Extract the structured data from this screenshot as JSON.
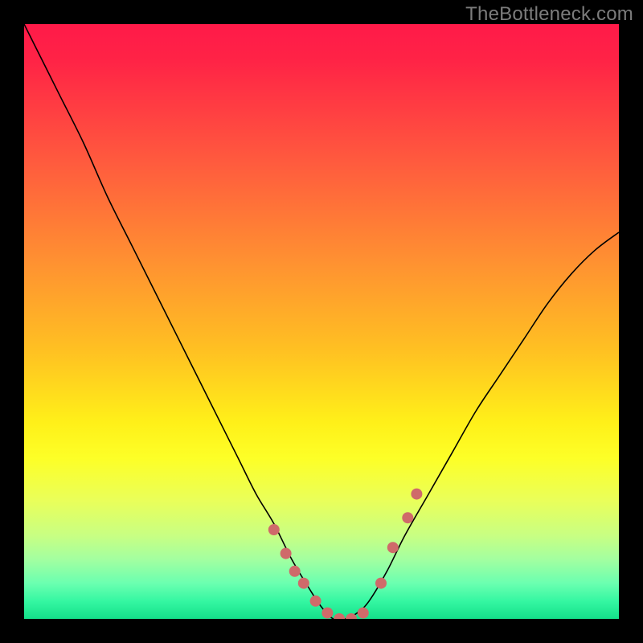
{
  "watermark": "TheBottleneck.com",
  "chart_data": {
    "type": "line",
    "title": "",
    "xlabel": "",
    "ylabel": "",
    "x_range": [
      0,
      100
    ],
    "y_range": [
      0,
      100
    ],
    "background_gradient": {
      "stops": [
        {
          "pos": 0.0,
          "color": "#ff1a49"
        },
        {
          "pos": 0.06,
          "color": "#ff2346"
        },
        {
          "pos": 0.23,
          "color": "#ff5a3e"
        },
        {
          "pos": 0.4,
          "color": "#ff9131"
        },
        {
          "pos": 0.55,
          "color": "#ffc122"
        },
        {
          "pos": 0.67,
          "color": "#fff019"
        },
        {
          "pos": 0.73,
          "color": "#fdff27"
        },
        {
          "pos": 0.8,
          "color": "#eaff59"
        },
        {
          "pos": 0.86,
          "color": "#c8ff83"
        },
        {
          "pos": 0.9,
          "color": "#a3ffa0"
        },
        {
          "pos": 0.94,
          "color": "#6bffb0"
        },
        {
          "pos": 0.97,
          "color": "#35f7a2"
        },
        {
          "pos": 1.0,
          "color": "#14e08a"
        }
      ]
    },
    "series": [
      {
        "name": "bottleneck-curve",
        "stroke": "#000000",
        "stroke_width": 1.6,
        "x": [
          0,
          3,
          6,
          10,
          14,
          18,
          22,
          26,
          30,
          33,
          36,
          39,
          42,
          45,
          48,
          50,
          52,
          54,
          56,
          58,
          61,
          64,
          68,
          72,
          76,
          80,
          84,
          88,
          92,
          96,
          100
        ],
        "y": [
          100,
          94,
          88,
          80,
          71,
          63,
          55,
          47,
          39,
          33,
          27,
          21,
          16,
          10,
          5,
          2,
          0,
          0,
          1,
          3,
          8,
          14,
          21,
          28,
          35,
          41,
          47,
          53,
          58,
          62,
          65
        ]
      }
    ],
    "markers": {
      "name": "marker-dots",
      "fill": "#cf6a6a",
      "radius_px": 7,
      "x": [
        42,
        44,
        45.5,
        47,
        49,
        51,
        53,
        55,
        57,
        60,
        62,
        64.5,
        66
      ],
      "y": [
        15,
        11,
        8,
        6,
        3,
        1,
        0,
        0,
        1,
        6,
        12,
        17,
        21
      ]
    }
  }
}
